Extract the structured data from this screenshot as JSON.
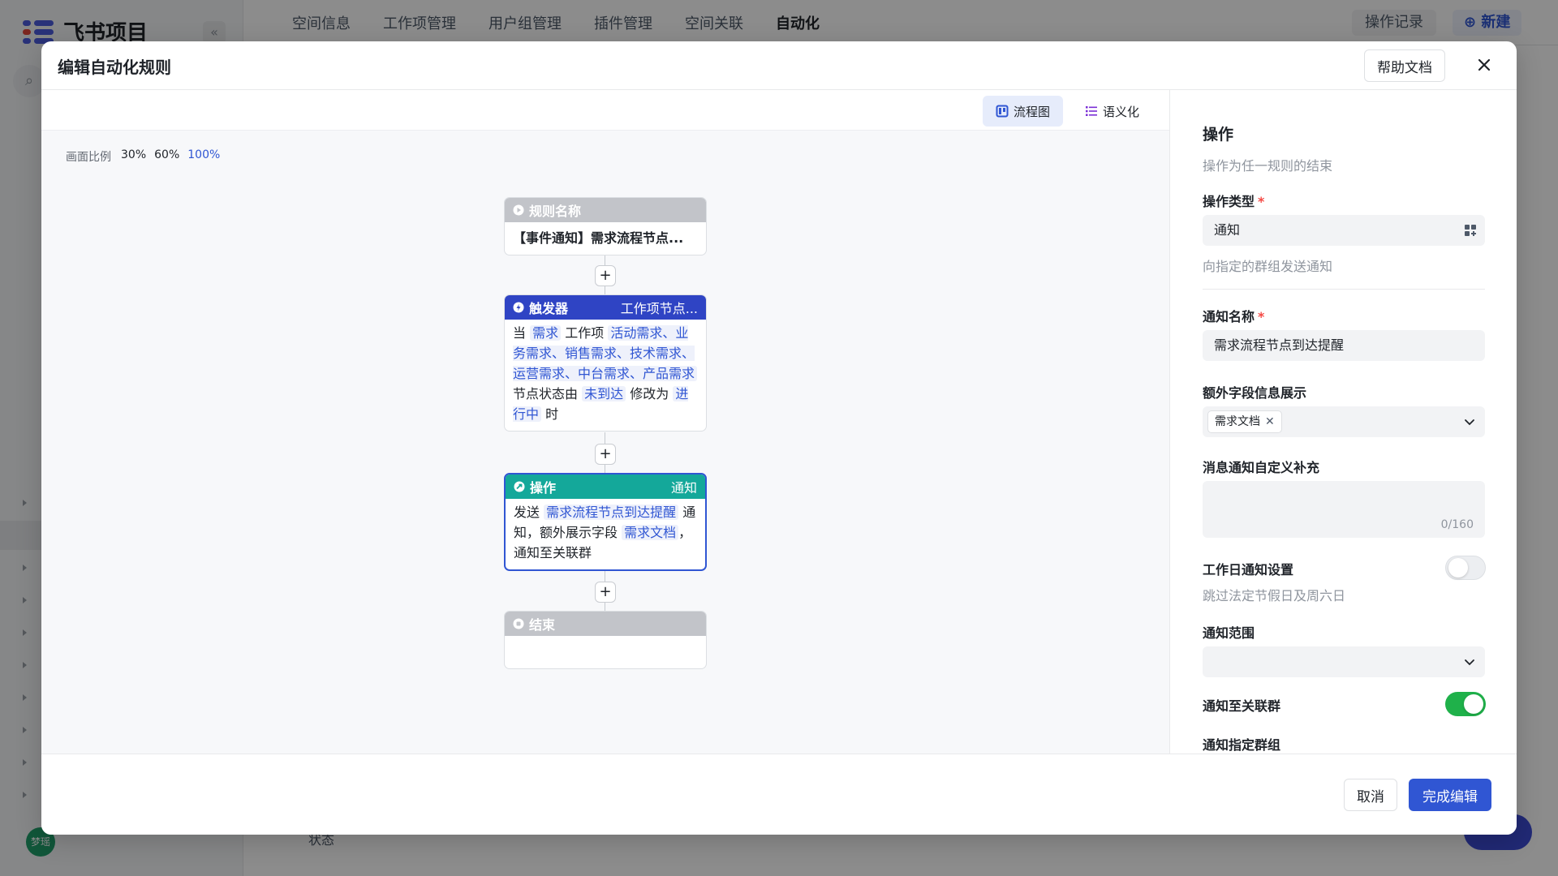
{
  "background": {
    "app_title": "飞书项目",
    "nav": [
      "空间信息",
      "工作项管理",
      "用户组管理",
      "插件管理",
      "空间关联",
      "自动化"
    ],
    "nav_active": "自动化",
    "op_log": "操作记录",
    "new_button": "新建",
    "avatar_text": "梦瑶",
    "bottom_text": "状态"
  },
  "modal": {
    "title": "编辑自动化规则",
    "help_button": "帮助文档",
    "view_flow": "流程图",
    "view_semantic": "语义化",
    "zoom_label": "画面比例",
    "zoom_options": [
      "30%",
      "60%",
      "100%"
    ],
    "zoom_active": "100%"
  },
  "flow": {
    "rule_node": {
      "header": "规则名称",
      "body": "【事件通知】需求流程节点..."
    },
    "trigger_node": {
      "header": "触发器",
      "header_right": "工作项节点...",
      "t_when": "当",
      "t_item": "需求",
      "t_type": "工作项",
      "t_types": "活动需求、业务需求、销售需求、技术需求、运营需求、中台需求、产品需求",
      "t_node": "节点状态由",
      "t_from": "未到达",
      "t_change": "修改为",
      "t_to": "进行中",
      "t_end": "时"
    },
    "action_node": {
      "header": "操作",
      "header_right": "通知",
      "a_send": "发送",
      "a_name": "需求流程节点到达提醒",
      "a_mid": "通知，额外展示字段",
      "a_field": "需求文档",
      "a_end": "，通知至关联群"
    },
    "end_node": {
      "header": "结束"
    }
  },
  "panel": {
    "title": "操作",
    "desc": "操作为任一规则的结束",
    "op_type_label": "操作类型",
    "op_type_value": "通知",
    "op_type_hint": "向指定的群组发送通知",
    "notice_name_label": "通知名称",
    "notice_name_value": "需求流程节点到达提醒",
    "extra_label": "额外字段信息展示",
    "extra_chip": "需求文档",
    "custom_label": "消息通知自定义补充",
    "custom_counter": "0/160",
    "workday_label": "工作日通知设置",
    "workday_hint": "跳过法定节假日及周六日",
    "range_label": "通知范围",
    "group_label": "通知至关联群",
    "assign_label": "通知指定群组"
  },
  "footer": {
    "cancel": "取消",
    "done": "完成编辑"
  },
  "colors": {
    "primary": "#3056d3",
    "trigger_header": "#2f44c4",
    "action_header": "#14a89a",
    "toggle_on": "#1fb14a"
  }
}
